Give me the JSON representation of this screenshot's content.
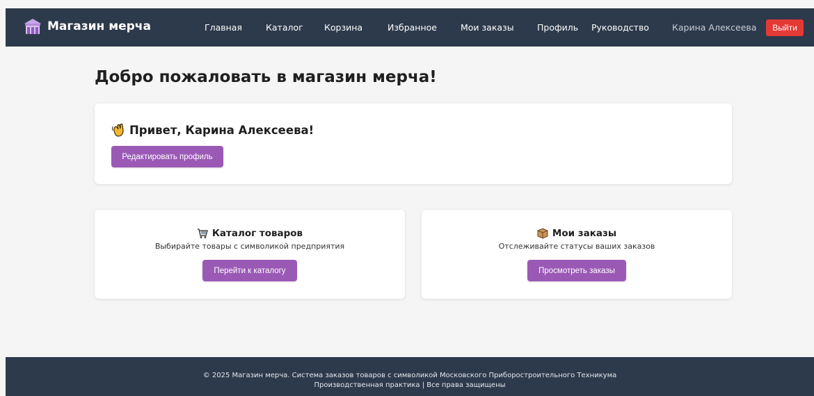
{
  "header": {
    "brand": "Магазин мерча",
    "nav": [
      "Главная",
      "Каталог",
      "Корзина",
      "Избранное",
      "Мои заказы",
      "Профиль",
      "Руководство"
    ],
    "user_name": "Карина Алексеева",
    "logout_label": "Выйти"
  },
  "main": {
    "title": "Добро пожаловать в магазин мерча!",
    "welcome": {
      "greeting": "Привет, Карина Алексеева!",
      "edit_profile_label": "Редактировать профиль"
    },
    "catalog_card": {
      "title": "Каталог товаров",
      "description": "Выбирайте товары с символикой предприятия",
      "button_label": "Перейти к каталогу"
    },
    "orders_card": {
      "title": "Мои заказы",
      "description": "Отслеживайте статусы ваших заказов",
      "button_label": "Просмотреть заказы"
    }
  },
  "footer": {
    "line1": "© 2025 Магазин мерча. Система заказов товаров с символикой Московского Приборостроительного Техникума",
    "line2": "Производственная практика | Все права защищены"
  },
  "colors": {
    "navbar_bg": "#2d3a4b",
    "accent_purple": "#9b59b6",
    "logout_red": "#e53935",
    "page_bg": "#f5f5f5"
  },
  "icons": {
    "brand": "store-icon",
    "greeting": "waving-hand-icon",
    "catalog": "shopping-cart-icon",
    "orders": "package-icon"
  }
}
